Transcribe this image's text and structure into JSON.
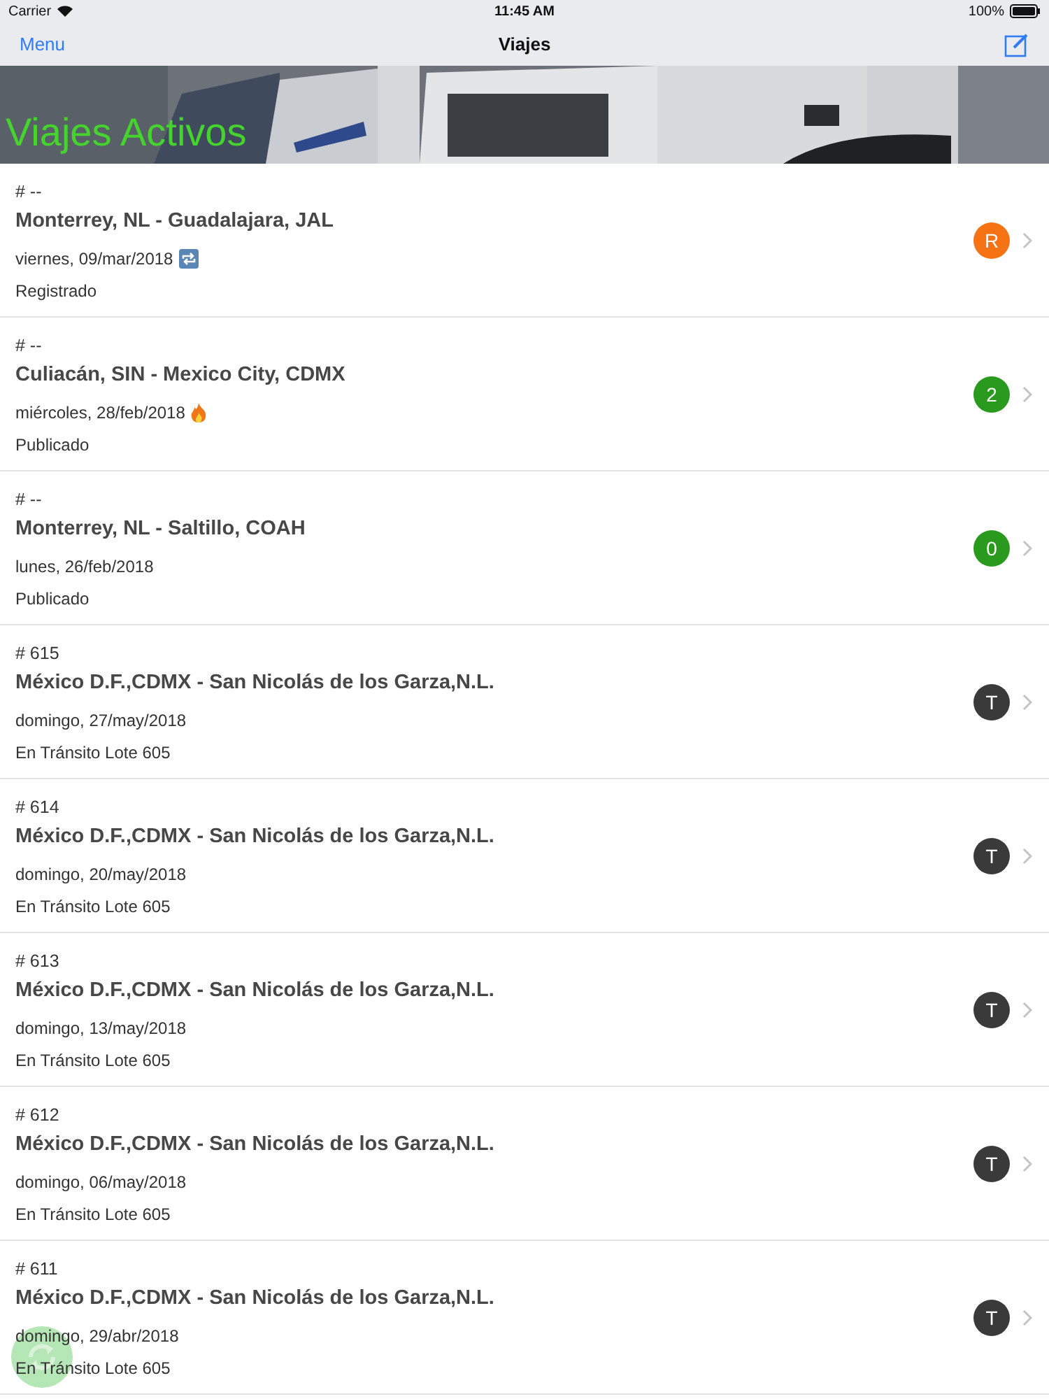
{
  "status_bar": {
    "carrier": "Carrier",
    "time": "11:45 AM",
    "battery": "100%"
  },
  "nav_bar": {
    "left_button": "Menu",
    "title": "Viajes"
  },
  "header": {
    "title": "Viajes Activos"
  },
  "trips": [
    {
      "kind": "repeat",
      "number": "# --",
      "route": "Monterrey, NL - Guadalajara, JAL",
      "date": "viernes, 09/mar/2018",
      "status": "Registrado",
      "badge": "R",
      "color": "#f57314"
    },
    {
      "kind": "fire",
      "number": "# --",
      "route": "Culiacán, SIN - Mexico City, CDMX",
      "date": "miércoles, 28/feb/2018",
      "status": "Publicado",
      "badge": "2",
      "color": "#2a9a1f"
    },
    {
      "kind": "plain",
      "number": "# --",
      "route": "Monterrey, NL - Saltillo, COAH",
      "date": "lunes, 26/feb/2018",
      "status": "Publicado",
      "badge": "0",
      "color": "#2a9a1f"
    },
    {
      "kind": "plain",
      "number": "# 615",
      "route": "México D.F.,CDMX - San Nicolás de los Garza,N.L.",
      "date": "domingo, 27/may/2018",
      "status": "En Tránsito Lote 605",
      "badge": "T",
      "color": "#3a3a3a"
    },
    {
      "kind": "plain",
      "number": "# 614",
      "route": "México D.F.,CDMX - San Nicolás de los Garza,N.L.",
      "date": "domingo, 20/may/2018",
      "status": "En Tránsito Lote 605",
      "badge": "T",
      "color": "#3a3a3a"
    },
    {
      "kind": "plain",
      "number": "# 613",
      "route": "México D.F.,CDMX - San Nicolás de los Garza,N.L.",
      "date": "domingo, 13/may/2018",
      "status": "En Tránsito Lote 605",
      "badge": "T",
      "color": "#3a3a3a"
    },
    {
      "kind": "plain",
      "number": "# 612",
      "route": "México D.F.,CDMX - San Nicolás de los Garza,N.L.",
      "date": "domingo, 06/may/2018",
      "status": "En Tránsito Lote 605",
      "badge": "T",
      "color": "#3a3a3a"
    },
    {
      "kind": "plain",
      "number": "# 611",
      "route": "México D.F.,CDMX - San Nicolás de los Garza,N.L.",
      "date": "domingo, 29/abr/2018",
      "status": "En Tránsito Lote 605",
      "badge": "T",
      "color": "#3a3a3a"
    }
  ]
}
